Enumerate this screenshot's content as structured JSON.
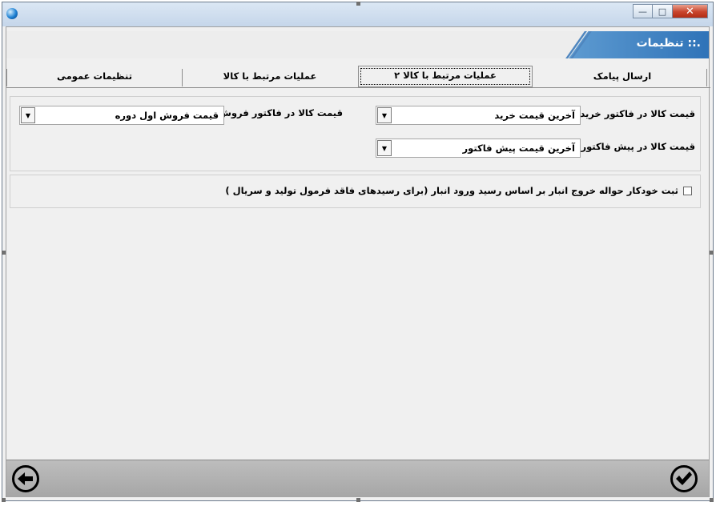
{
  "window": {
    "title": ".:: تنظيمات",
    "controls": {
      "minimize": "—",
      "maximize": "□",
      "close": "✕"
    }
  },
  "tabs": [
    {
      "label": "ارسال پیامک",
      "active": false
    },
    {
      "label": "عمليات مرتبط با كالا ٢",
      "active": true
    },
    {
      "label": "عمليات مرتبط با كالا",
      "active": false
    },
    {
      "label": "تنظيمات عمومى",
      "active": false
    }
  ],
  "prices": {
    "purchase_label": "قيمت كالا در فاكتور خريد :",
    "purchase_value": "آخرين قيمت خريد",
    "proforma_label": "قيمت كالا در پيش فاكتور :",
    "proforma_value": "آخرين قيمت پيش فاكتور",
    "sales_label": "قيمت كالا در فاكتور فروش :",
    "sales_value": "قيمت فروش اول دوره"
  },
  "auto_register": {
    "label": "ثبت خودكار حواله خروج انبار بر اساس رسيد ورود انبار (براى رسيدهاى فاقد فرمول توليد و سريال )",
    "checked": false
  },
  "icons": {
    "app": "app-globe-icon",
    "back": "back-arrow-icon",
    "confirm": "confirm-check-icon"
  },
  "colors": {
    "header_band": "#2f73b8",
    "close_button": "#c8442c"
  }
}
